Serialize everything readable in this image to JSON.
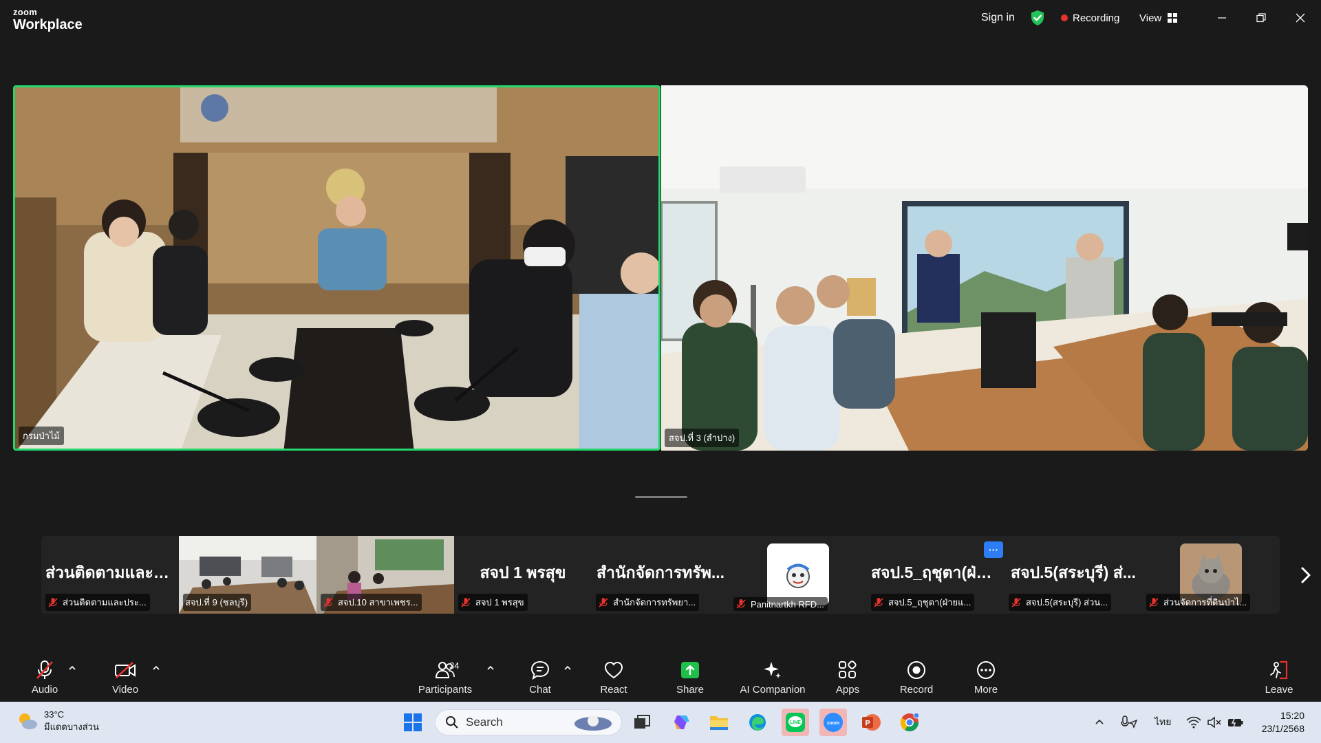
{
  "window": {
    "brand_small": "zoom",
    "brand_big": "Workplace",
    "sign_in": "Sign in",
    "recording": "Recording",
    "view": "View"
  },
  "main_tiles": [
    {
      "name": "กรมป่าไม้"
    },
    {
      "name": "สจป.ที่ 3 (ลำปาง)"
    }
  ],
  "gallery": [
    {
      "title": "ส่วนติดตามและป...",
      "label": "ส่วนติดตามและประ..."
    },
    {
      "title": "",
      "label": "สจป.ที่ 9 (ชลบุรี)"
    },
    {
      "title": "",
      "label": "สจป.10 สาขาเพชร..."
    },
    {
      "title": "สจป 1 พรสุข",
      "label": "สจป 1 พรสุข"
    },
    {
      "title": "สำนักจัดการทรัพ...",
      "label": "สำนักจัดการทรัพยา..."
    },
    {
      "title": "",
      "label": "Panitnartkh RFD..."
    },
    {
      "title": "สจป.5_ฤชุตา(ฝ่าย...",
      "label": "สจป.5_ฤชุตา(ฝ่ายแ..."
    },
    {
      "title": "สจป.5(สระบุรี) ส่...",
      "label": "สจป.5(สระบุรี) ส่วน..."
    },
    {
      "title": "",
      "label": "ส่วนจัดการที่ดินป่าไ..."
    }
  ],
  "gallery_more_badge": "···",
  "toolbar": {
    "audio": "Audio",
    "video": "Video",
    "participants": "Participants",
    "participants_count": "34",
    "chat": "Chat",
    "react": "React",
    "share": "Share",
    "ai_companion": "AI Companion",
    "apps": "Apps",
    "record": "Record",
    "more": "More",
    "leave": "Leave"
  },
  "taskbar": {
    "temperature": "33°C",
    "weather_desc": "มีแดดบางส่วน",
    "search_placeholder": "Search",
    "language": "ไทย",
    "time": "15:20",
    "date": "23/1/2568",
    "icons": [
      "windows-start-icon",
      "task-view-icon",
      "copilot-icon",
      "file-explorer-icon",
      "edge-icon",
      "line-icon",
      "zoom-icon",
      "powerpoint-icon",
      "chrome-icon"
    ]
  },
  "colors": {
    "active_speaker_border": "#23d96b",
    "recording_dot": "#e5322d",
    "share_green": "#1fbf4a",
    "leave_red": "#e5322d"
  }
}
